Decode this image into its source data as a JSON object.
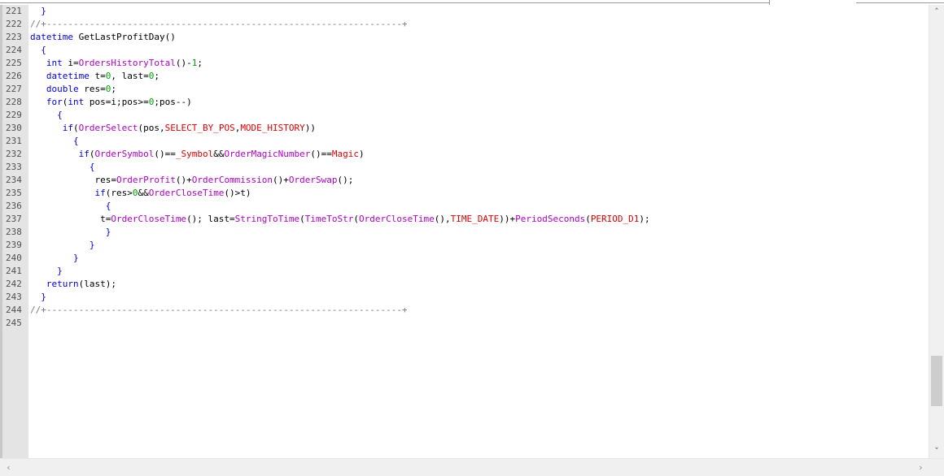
{
  "editor": {
    "lines": [
      {
        "num": "221",
        "segs": [
          {
            "t": "  }",
            "c": "kw"
          }
        ]
      },
      {
        "num": "222",
        "segs": [
          {
            "t": "//+------------------------------------------------------------------+",
            "c": "cm"
          }
        ]
      },
      {
        "num": "223",
        "segs": [
          {
            "t": "datetime",
            "c": "kw"
          },
          {
            "t": " GetLastProfitDay()",
            "c": "plain"
          }
        ]
      },
      {
        "num": "224",
        "segs": [
          {
            "t": "  {",
            "c": "kw"
          }
        ]
      },
      {
        "num": "225",
        "segs": [
          {
            "t": "   int",
            "c": "kw"
          },
          {
            "t": " i=",
            "c": "plain"
          },
          {
            "t": "OrdersHistoryTotal",
            "c": "fn"
          },
          {
            "t": "()-",
            "c": "plain"
          },
          {
            "t": "1",
            "c": "num"
          },
          {
            "t": ";",
            "c": "plain"
          }
        ]
      },
      {
        "num": "226",
        "segs": [
          {
            "t": "   datetime",
            "c": "kw"
          },
          {
            "t": " t=",
            "c": "plain"
          },
          {
            "t": "0",
            "c": "num"
          },
          {
            "t": ", last=",
            "c": "plain"
          },
          {
            "t": "0",
            "c": "num"
          },
          {
            "t": ";",
            "c": "plain"
          }
        ]
      },
      {
        "num": "227",
        "segs": [
          {
            "t": "   double",
            "c": "kw"
          },
          {
            "t": " res=",
            "c": "plain"
          },
          {
            "t": "0",
            "c": "num"
          },
          {
            "t": ";",
            "c": "plain"
          }
        ]
      },
      {
        "num": "228",
        "segs": [
          {
            "t": "   for",
            "c": "kw"
          },
          {
            "t": "(",
            "c": "plain"
          },
          {
            "t": "int",
            "c": "kw"
          },
          {
            "t": " pos=i;pos>=",
            "c": "plain"
          },
          {
            "t": "0",
            "c": "num"
          },
          {
            "t": ";pos--)",
            "c": "plain"
          }
        ]
      },
      {
        "num": "229",
        "segs": [
          {
            "t": "     {",
            "c": "kw"
          }
        ]
      },
      {
        "num": "230",
        "segs": [
          {
            "t": "      if",
            "c": "kw"
          },
          {
            "t": "(",
            "c": "plain"
          },
          {
            "t": "OrderSelect",
            "c": "fn"
          },
          {
            "t": "(pos,",
            "c": "plain"
          },
          {
            "t": "SELECT_BY_POS",
            "c": "cst"
          },
          {
            "t": ",",
            "c": "plain"
          },
          {
            "t": "MODE_HISTORY",
            "c": "cst"
          },
          {
            "t": "))",
            "c": "plain"
          }
        ]
      },
      {
        "num": "231",
        "segs": [
          {
            "t": "        {",
            "c": "kw"
          }
        ]
      },
      {
        "num": "232",
        "segs": [
          {
            "t": "         if",
            "c": "kw"
          },
          {
            "t": "(",
            "c": "plain"
          },
          {
            "t": "OrderSymbol",
            "c": "fn"
          },
          {
            "t": "()==",
            "c": "plain"
          },
          {
            "t": "_Symbol",
            "c": "cst"
          },
          {
            "t": "&&",
            "c": "plain"
          },
          {
            "t": "OrderMagicNumber",
            "c": "fn"
          },
          {
            "t": "()==",
            "c": "plain"
          },
          {
            "t": "Magic",
            "c": "cst"
          },
          {
            "t": ")",
            "c": "plain"
          }
        ]
      },
      {
        "num": "233",
        "segs": [
          {
            "t": "           {",
            "c": "kw"
          }
        ]
      },
      {
        "num": "234",
        "segs": [
          {
            "t": "            res=",
            "c": "plain"
          },
          {
            "t": "OrderProfit",
            "c": "fn"
          },
          {
            "t": "()+",
            "c": "plain"
          },
          {
            "t": "OrderCommission",
            "c": "fn"
          },
          {
            "t": "()+",
            "c": "plain"
          },
          {
            "t": "OrderSwap",
            "c": "fn"
          },
          {
            "t": "();",
            "c": "plain"
          }
        ]
      },
      {
        "num": "235",
        "segs": [
          {
            "t": "            if",
            "c": "kw"
          },
          {
            "t": "(res>",
            "c": "plain"
          },
          {
            "t": "0",
            "c": "num"
          },
          {
            "t": "&&",
            "c": "plain"
          },
          {
            "t": "OrderCloseTime",
            "c": "fn"
          },
          {
            "t": "()>t)",
            "c": "plain"
          }
        ]
      },
      {
        "num": "236",
        "segs": [
          {
            "t": "              {",
            "c": "kw"
          }
        ]
      },
      {
        "num": "237",
        "segs": [
          {
            "t": "             t=",
            "c": "plain"
          },
          {
            "t": "OrderCloseTime",
            "c": "fn"
          },
          {
            "t": "(); last=",
            "c": "plain"
          },
          {
            "t": "StringToTime",
            "c": "fn"
          },
          {
            "t": "(",
            "c": "plain"
          },
          {
            "t": "TimeToStr",
            "c": "fn"
          },
          {
            "t": "(",
            "c": "plain"
          },
          {
            "t": "OrderCloseTime",
            "c": "fn"
          },
          {
            "t": "(),",
            "c": "plain"
          },
          {
            "t": "TIME_DATE",
            "c": "cst"
          },
          {
            "t": "))+",
            "c": "plain"
          },
          {
            "t": "PeriodSeconds",
            "c": "fn"
          },
          {
            "t": "(",
            "c": "plain"
          },
          {
            "t": "PERIOD_D1",
            "c": "cst"
          },
          {
            "t": ");",
            "c": "plain"
          }
        ]
      },
      {
        "num": "238",
        "segs": [
          {
            "t": "              }",
            "c": "kw"
          }
        ]
      },
      {
        "num": "239",
        "segs": [
          {
            "t": "           }",
            "c": "kw"
          }
        ]
      },
      {
        "num": "240",
        "segs": [
          {
            "t": "        }",
            "c": "kw"
          }
        ]
      },
      {
        "num": "241",
        "segs": [
          {
            "t": "     }",
            "c": "kw"
          }
        ]
      },
      {
        "num": "242",
        "segs": [
          {
            "t": "   return",
            "c": "kw"
          },
          {
            "t": "(last);",
            "c": "plain"
          }
        ]
      },
      {
        "num": "243",
        "segs": [
          {
            "t": "  }",
            "c": "kw"
          }
        ]
      },
      {
        "num": "244",
        "segs": [
          {
            "t": "//+------------------------------------------------------------------+",
            "c": "cm"
          }
        ]
      },
      {
        "num": "245",
        "segs": []
      }
    ]
  },
  "scrollbars": {
    "up_icon": "chevron-up-icon",
    "down_icon": "chevron-down-icon",
    "left_icon": "chevron-left-icon",
    "right_icon": "chevron-right-icon",
    "up_glyph": "˄",
    "down_glyph": "˅",
    "left_glyph": "‹",
    "right_glyph": "›"
  }
}
